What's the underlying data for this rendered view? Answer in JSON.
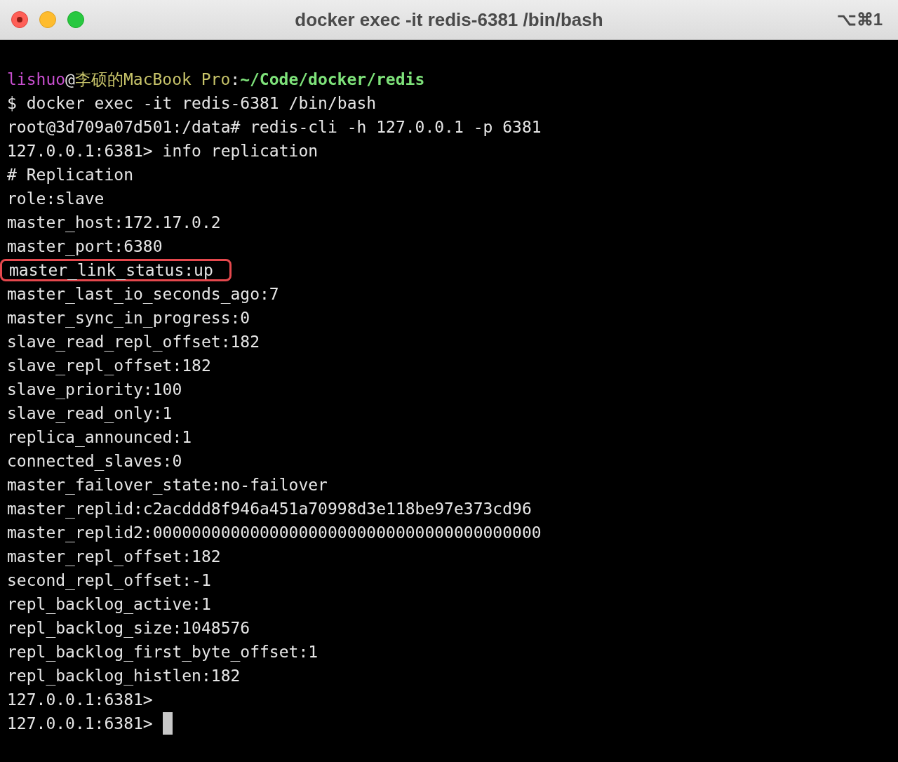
{
  "window": {
    "title": "docker exec -it redis-6381 /bin/bash",
    "shortcut": "⌥⌘1"
  },
  "prompt": [
    {
      "kind": "user",
      "text": "lishuo"
    },
    {
      "kind": "plain",
      "text": "@"
    },
    {
      "kind": "host",
      "text": "李硕的MacBook Pro"
    },
    {
      "kind": "plain",
      "text": ":"
    },
    {
      "kind": "path",
      "text": "~/Code/docker/redis"
    }
  ],
  "lines": [
    {
      "text": "$ docker exec -it redis-6381 /bin/bash",
      "highlighted": false,
      "cursor": false
    },
    {
      "text": "root@3d709a07d501:/data# redis-cli -h 127.0.0.1 -p 6381",
      "highlighted": false,
      "cursor": false
    },
    {
      "text": "127.0.0.1:6381> info replication",
      "highlighted": false,
      "cursor": false
    },
    {
      "text": "# Replication",
      "highlighted": false,
      "cursor": false
    },
    {
      "text": "role:slave",
      "highlighted": false,
      "cursor": false
    },
    {
      "text": "master_host:172.17.0.2",
      "highlighted": false,
      "cursor": false
    },
    {
      "text": "master_port:6380",
      "highlighted": false,
      "cursor": false
    },
    {
      "text": "master_link_status:up",
      "highlighted": true,
      "cursor": false
    },
    {
      "text": "master_last_io_seconds_ago:7",
      "highlighted": false,
      "cursor": false
    },
    {
      "text": "master_sync_in_progress:0",
      "highlighted": false,
      "cursor": false
    },
    {
      "text": "slave_read_repl_offset:182",
      "highlighted": false,
      "cursor": false
    },
    {
      "text": "slave_repl_offset:182",
      "highlighted": false,
      "cursor": false
    },
    {
      "text": "slave_priority:100",
      "highlighted": false,
      "cursor": false
    },
    {
      "text": "slave_read_only:1",
      "highlighted": false,
      "cursor": false
    },
    {
      "text": "replica_announced:1",
      "highlighted": false,
      "cursor": false
    },
    {
      "text": "connected_slaves:0",
      "highlighted": false,
      "cursor": false
    },
    {
      "text": "master_failover_state:no-failover",
      "highlighted": false,
      "cursor": false
    },
    {
      "text": "master_replid:c2acddd8f946a451a70998d3e118be97e373cd96",
      "highlighted": false,
      "cursor": false
    },
    {
      "text": "master_replid2:0000000000000000000000000000000000000000",
      "highlighted": false,
      "cursor": false
    },
    {
      "text": "master_repl_offset:182",
      "highlighted": false,
      "cursor": false
    },
    {
      "text": "second_repl_offset:-1",
      "highlighted": false,
      "cursor": false
    },
    {
      "text": "repl_backlog_active:1",
      "highlighted": false,
      "cursor": false
    },
    {
      "text": "repl_backlog_size:1048576",
      "highlighted": false,
      "cursor": false
    },
    {
      "text": "repl_backlog_first_byte_offset:1",
      "highlighted": false,
      "cursor": false
    },
    {
      "text": "repl_backlog_histlen:182",
      "highlighted": false,
      "cursor": false
    },
    {
      "text": "127.0.0.1:6381>",
      "highlighted": false,
      "cursor": false
    },
    {
      "text": "127.0.0.1:6381>",
      "highlighted": false,
      "cursor": true
    }
  ]
}
